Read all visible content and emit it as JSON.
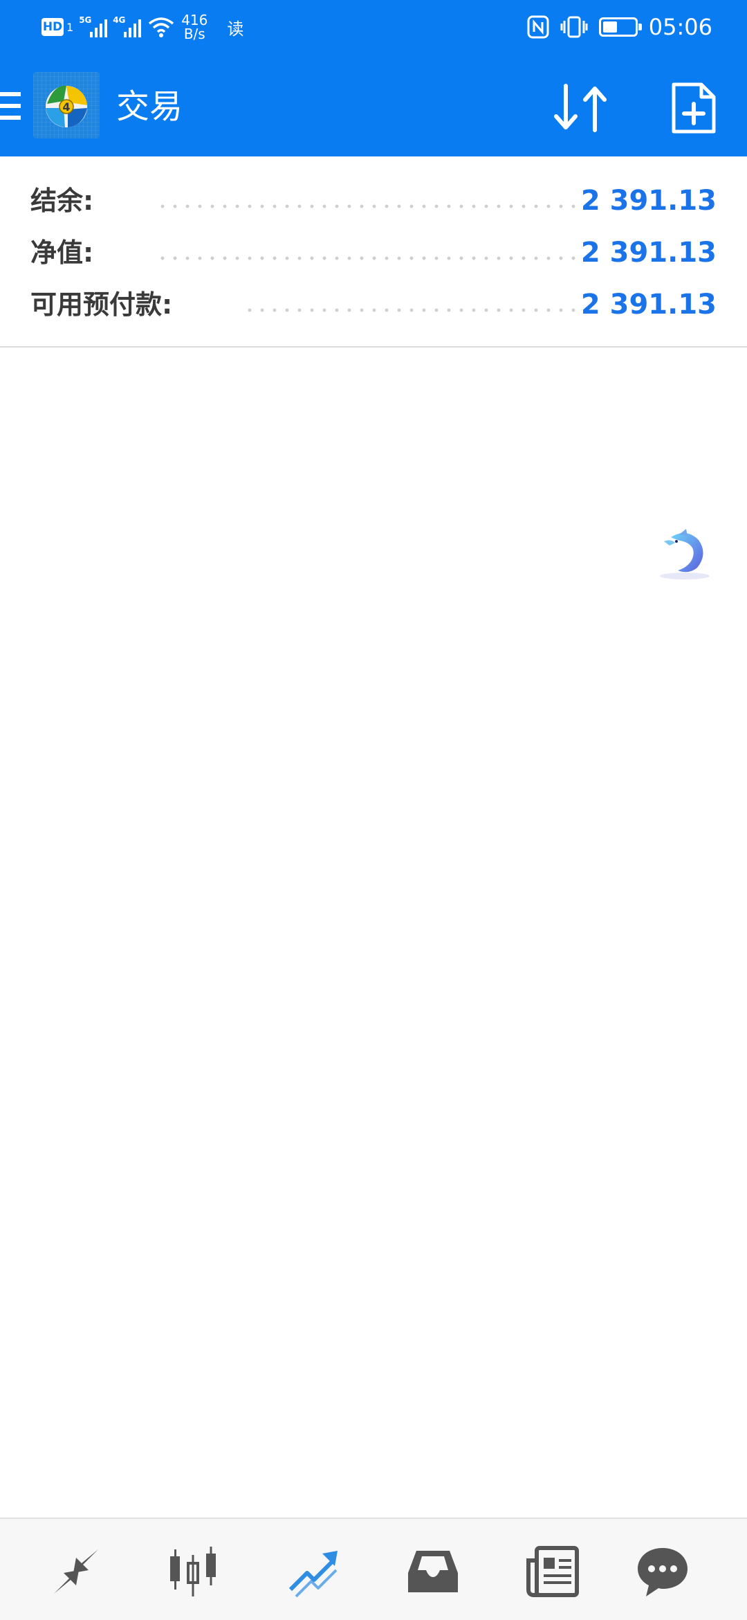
{
  "status_bar": {
    "hd_label": "HD",
    "sim_number": "1",
    "signal_1_label": "5G",
    "signal_2_label": "4G",
    "speed_value": "416",
    "speed_unit": "B/s",
    "reader_mode": "读",
    "battery_level": 0.45,
    "time": "05:06",
    "icons": [
      "hd-icon",
      "signal-icon",
      "signal-icon",
      "wifi-icon",
      "nfc-icon",
      "vibrate-icon",
      "battery-icon"
    ]
  },
  "app_bar": {
    "title": "交易",
    "icons": [
      "menu-icon",
      "metatrader-logo-icon",
      "sort-icon",
      "new-order-icon"
    ]
  },
  "summary": {
    "rows": [
      {
        "label": "结余:",
        "value": "2 391.13"
      },
      {
        "label": "净值:",
        "value": "2 391.13"
      },
      {
        "label": "可用预付款:",
        "value": "2 391.13"
      }
    ]
  },
  "bottom_nav": {
    "items": [
      {
        "name": "quotes",
        "icon": "quotes-arrows-icon",
        "active": false
      },
      {
        "name": "charts",
        "icon": "candlestick-icon",
        "active": false
      },
      {
        "name": "trade",
        "icon": "trade-trend-icon",
        "active": true
      },
      {
        "name": "history",
        "icon": "inbox-icon",
        "active": false
      },
      {
        "name": "news",
        "icon": "newspaper-icon",
        "active": false
      },
      {
        "name": "messages",
        "icon": "chat-icon",
        "active": false
      }
    ]
  },
  "colors": {
    "primary": "#0a7cf2",
    "value_blue": "#1a73e8",
    "nav_icon": "#555555",
    "nav_active": "#2f8de4"
  }
}
